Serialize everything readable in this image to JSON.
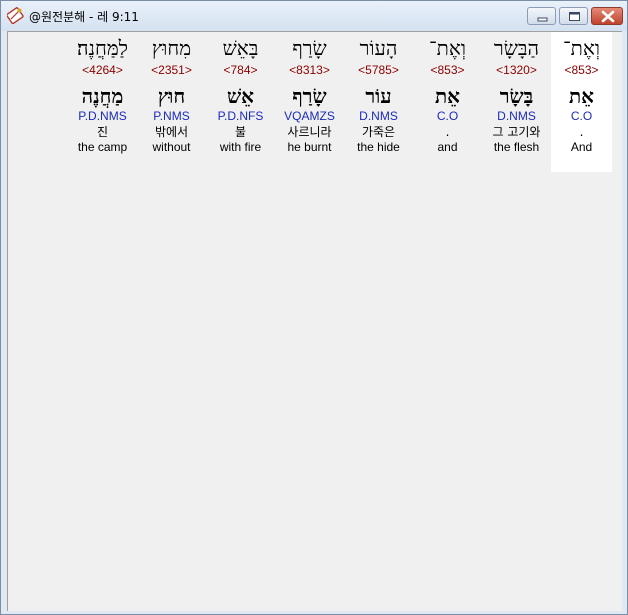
{
  "window": {
    "title": "@원전분해 - 레 9:11"
  },
  "colors": {
    "strong_number": "#8b0000",
    "parsing": "#1b2bb8",
    "selected_background": "#ffffff",
    "client_background": "#f0f0f0"
  },
  "words": [
    {
      "surface": "וְאֶת־",
      "strong": "<853>",
      "lexeme": "אֵת",
      "parsing": "C.O",
      "korean": ".",
      "english": "And",
      "selected": true
    },
    {
      "surface": "הַבָּשָׂר",
      "strong": "<1320>",
      "lexeme": "בָּשָׂר",
      "parsing": "D.NMS",
      "korean": "그 고기와",
      "english": "the flesh"
    },
    {
      "surface": "וְאֶת־",
      "strong": "<853>",
      "lexeme": "אֵת",
      "parsing": "C.O",
      "korean": ".",
      "english": "and"
    },
    {
      "surface": "הָעוֹר",
      "strong": "<5785>",
      "lexeme": "עוֹר",
      "parsing": "D.NMS",
      "korean": "가죽은",
      "english": "the hide"
    },
    {
      "surface": "שָׂרַף",
      "strong": "<8313>",
      "lexeme": "שָׂרַף",
      "parsing": "VQAMZS",
      "korean": "사르니라",
      "english": "he burnt"
    },
    {
      "surface": "בָּאֵשׁ",
      "strong": "<784>",
      "lexeme": "אֵשׁ",
      "parsing": "P.D.NFS",
      "korean": "불",
      "english": "with fire"
    },
    {
      "surface": "מִחוּץ",
      "strong": "<2351>",
      "lexeme": "חוּץ",
      "parsing": "P.NMS",
      "korean": "밖에서",
      "english": "without"
    },
    {
      "surface": "לַמַּחֲנֶה׃",
      "strong": "<4264>",
      "lexeme": "מַחֲנֶה",
      "parsing": "P.D.NMS",
      "korean": "진",
      "english": "the camp"
    }
  ]
}
